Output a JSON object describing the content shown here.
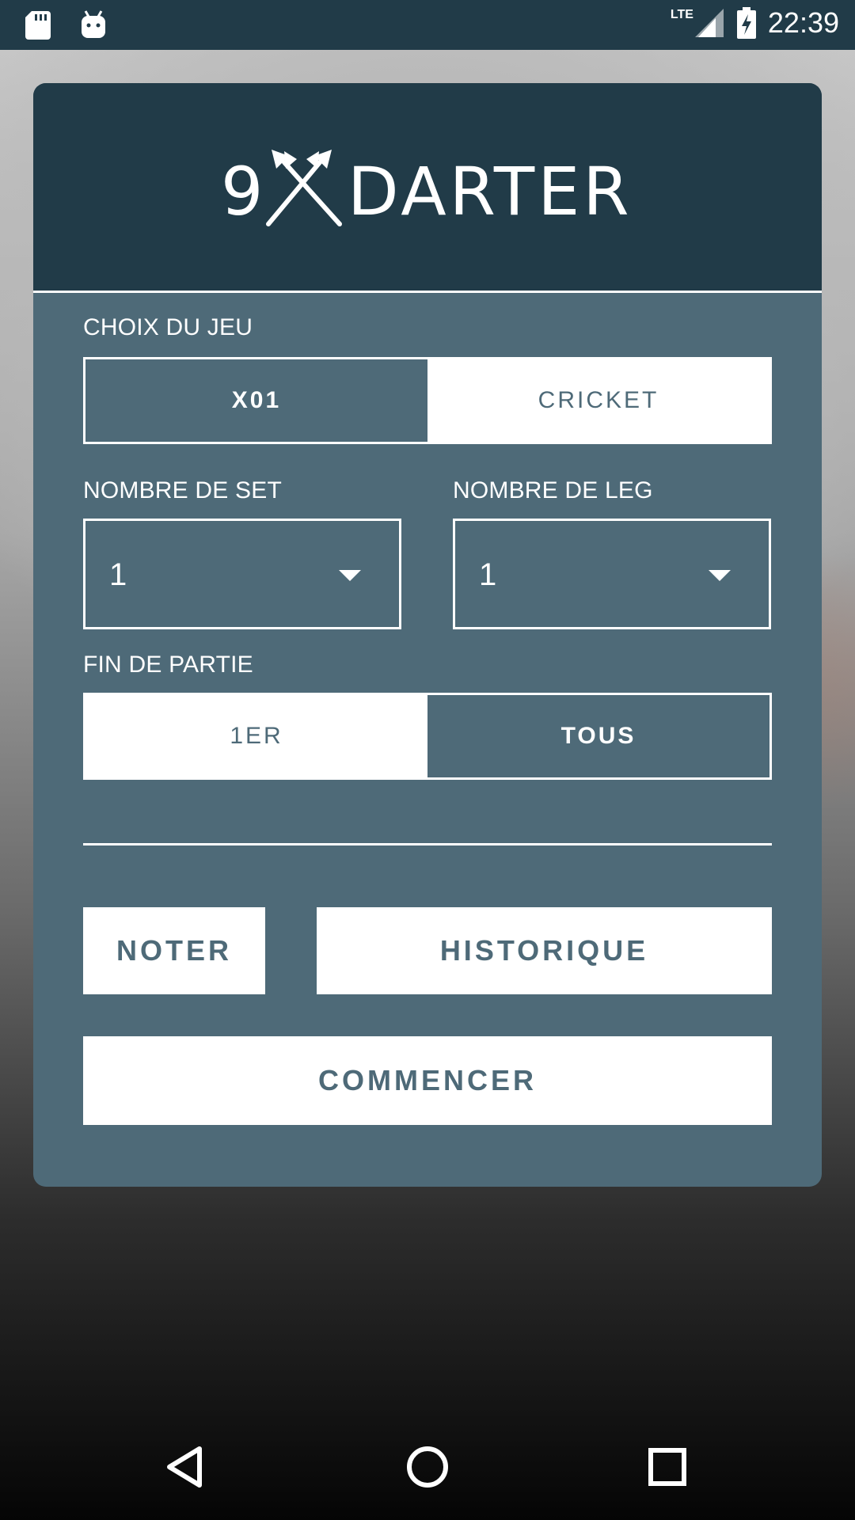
{
  "status_bar": {
    "time": "22:39",
    "network": "LTE",
    "icons": [
      "sd-card-icon",
      "android-icon",
      "lte-signal-icon",
      "battery-charging-icon"
    ]
  },
  "app": {
    "logo_text_prefix": "9",
    "logo_text": "DARTER",
    "colors": {
      "header": "#213b48",
      "panel": "#4e6a78",
      "accent": "#ffffff"
    }
  },
  "game_choice": {
    "label": "CHOIX DU JEU",
    "options": [
      "X01",
      "CRICKET"
    ],
    "selected": "X01"
  },
  "sets": {
    "label": "NOMBRE DE SET",
    "value": "1"
  },
  "legs": {
    "label": "NOMBRE DE LEG",
    "value": "1"
  },
  "end_of_game": {
    "label": "FIN DE PARTIE",
    "options": [
      "1ER",
      "TOUS"
    ],
    "selected": "TOUS"
  },
  "buttons": {
    "rate": "NOTER",
    "history": "HISTORIQUE",
    "start": "COMMENCER"
  },
  "nav": {
    "icons": [
      "back-icon",
      "home-icon",
      "recents-icon"
    ]
  }
}
